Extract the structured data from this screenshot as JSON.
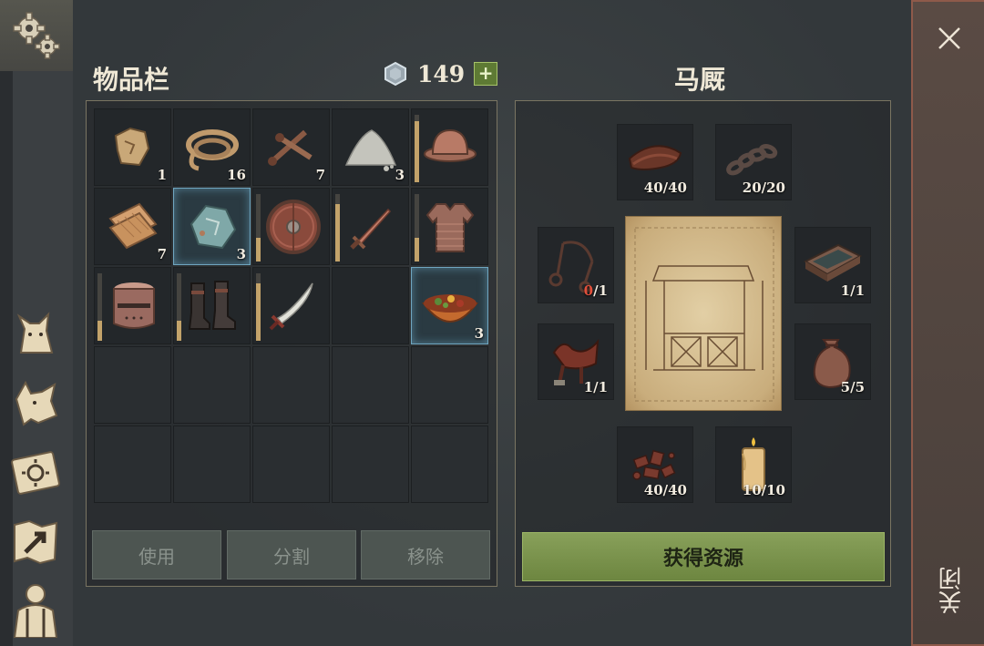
{
  "inventory": {
    "title": "物品栏",
    "currency": {
      "amount": "149",
      "icon": "silver-coin-icon",
      "plus_label": "+"
    },
    "slots": [
      {
        "name": "scrap-item",
        "icon": "scrap-icon",
        "count": "1"
      },
      {
        "name": "rope-item",
        "icon": "rope-icon",
        "count": "16"
      },
      {
        "name": "nails-item",
        "icon": "nails-icon",
        "count": "7"
      },
      {
        "name": "powder-item",
        "icon": "powder-pile-icon",
        "count": "3"
      },
      {
        "name": "helmet-item",
        "icon": "kettle-helmet-icon",
        "count": "",
        "durability": 0.9
      },
      {
        "name": "cloth-item",
        "icon": "cloth-roll-icon",
        "count": "7"
      },
      {
        "name": "ore-item",
        "icon": "ore-chunk-icon",
        "count": "3",
        "selected": true
      },
      {
        "name": "shield-item",
        "icon": "round-shield-icon",
        "count": "",
        "durability": 0.35
      },
      {
        "name": "dagger-item",
        "icon": "dagger-icon",
        "count": "",
        "durability": 0.85
      },
      {
        "name": "chainmail-item",
        "icon": "chainmail-icon",
        "count": "",
        "durability": 0.35
      },
      {
        "name": "great-helm-item",
        "icon": "great-helm-icon",
        "count": "",
        "durability": 0.3
      },
      {
        "name": "boots-item",
        "icon": "boots-icon",
        "count": "",
        "durability": 0.3
      },
      {
        "name": "sword-item",
        "icon": "curved-sword-icon",
        "count": "",
        "durability": 0.85
      },
      {
        "name": "empty-slot",
        "icon": "",
        "count": ""
      },
      {
        "name": "stew-item",
        "icon": "stew-bowl-icon",
        "count": "3",
        "selected": true
      }
    ],
    "buttons": {
      "use": "使用",
      "split": "分割",
      "remove": "移除"
    }
  },
  "stable": {
    "title": "马厩",
    "requirements": [
      {
        "name": "leather-req",
        "icon": "leather-strap-icon",
        "have": "40",
        "sep": "/",
        "need": "40",
        "short": false
      },
      {
        "name": "chain-req",
        "icon": "chain-icon",
        "have": "20",
        "sep": "/",
        "need": "20",
        "short": false
      },
      {
        "name": "bridle-req",
        "icon": "bridle-icon",
        "have": "0",
        "sep": "/",
        "need": "1",
        "short": true
      },
      {
        "name": "trough-req",
        "icon": "trough-icon",
        "have": "1",
        "sep": "/",
        "need": "1",
        "short": false
      },
      {
        "name": "saddle-req",
        "icon": "saddle-icon",
        "have": "1",
        "sep": "/",
        "need": "1",
        "short": false
      },
      {
        "name": "sack-req",
        "icon": "sack-icon",
        "have": "5",
        "sep": "/",
        "need": "5",
        "short": false
      },
      {
        "name": "scrap-metal-req",
        "icon": "scrap-metal-icon",
        "have": "40",
        "sep": "/",
        "need": "40",
        "short": false
      },
      {
        "name": "candle-req",
        "icon": "candle-icon",
        "have": "10",
        "sep": "/",
        "need": "10",
        "short": false
      }
    ],
    "blueprint_icon": "stable-blueprint-icon",
    "gain_button": "获得资源"
  },
  "sidebar": [
    "settings-gears-icon",
    "cat-icon",
    "dog-icon",
    "sun-book-icon",
    "map-icon",
    "character-icon"
  ],
  "close": {
    "label": "关闭",
    "icon": "close-icon"
  },
  "colors": {
    "accent_green": "#7a9448",
    "shortage_red": "#e0503c",
    "selected_blue": "#6fa6c0"
  }
}
